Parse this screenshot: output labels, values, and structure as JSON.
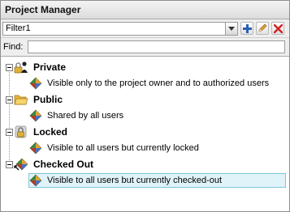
{
  "window": {
    "title": "Project Manager"
  },
  "filter": {
    "value": "Filter1"
  },
  "find": {
    "label": "Find:",
    "value": ""
  },
  "tree": {
    "groups": [
      {
        "label": "Private",
        "icon": "lock-person-icon",
        "child": {
          "label": "Visible only to the project owner and to authorized users",
          "icon": "project-icon"
        }
      },
      {
        "label": "Public",
        "icon": "open-folder-icon",
        "child": {
          "label": "Shared by all users",
          "icon": "project-icon"
        }
      },
      {
        "label": "Locked",
        "icon": "lock-icon",
        "child": {
          "label": "Visible to all users but currently locked",
          "icon": "project-icon"
        }
      },
      {
        "label": "Checked Out",
        "icon": "checkout-icon",
        "child": {
          "label": "Visible to all users but currently checked-out",
          "icon": "project-icon",
          "selected": true
        }
      }
    ]
  }
}
